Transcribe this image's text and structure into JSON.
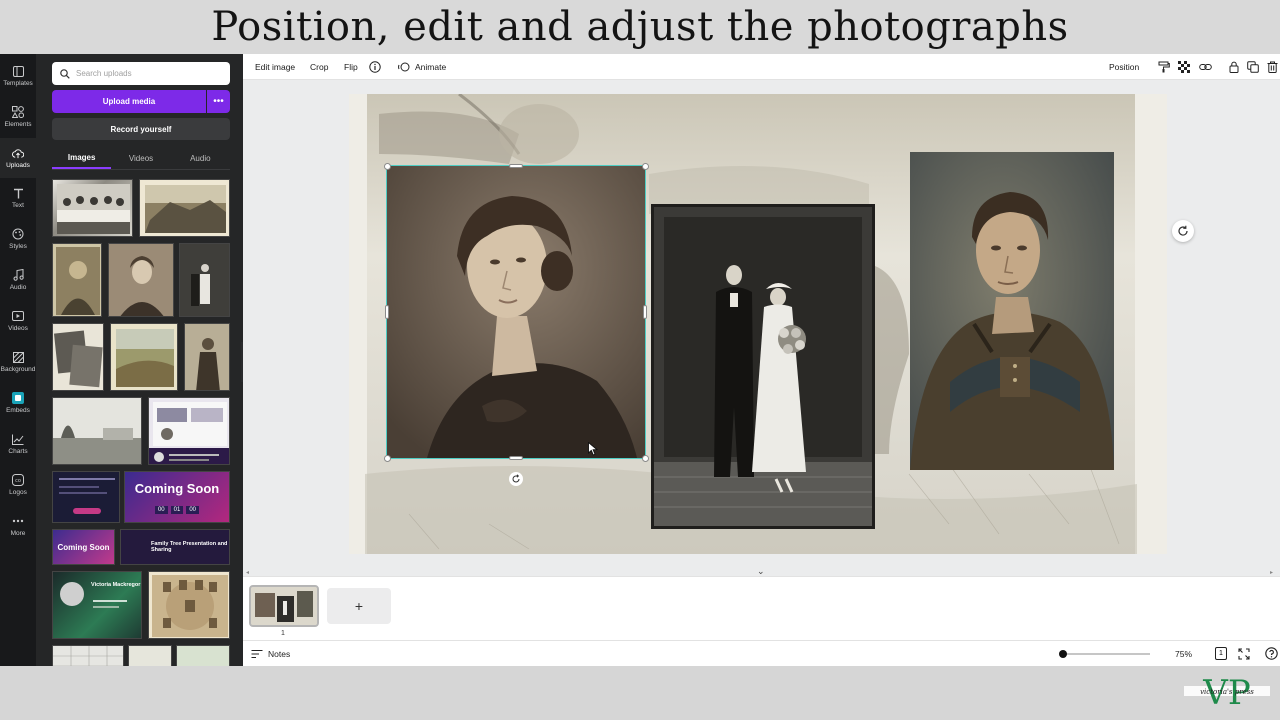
{
  "banner": {
    "title": "Position, edit and adjust the photographs"
  },
  "rail": {
    "items": [
      {
        "label": "Templates",
        "icon": "templates-icon"
      },
      {
        "label": "Elements",
        "icon": "elements-icon"
      },
      {
        "label": "Uploads",
        "icon": "cloud-upload-icon",
        "active": true
      },
      {
        "label": "Text",
        "icon": "text-icon"
      },
      {
        "label": "Styles",
        "icon": "palette-icon"
      },
      {
        "label": "Audio",
        "icon": "music-note-icon"
      },
      {
        "label": "Videos",
        "icon": "video-icon"
      },
      {
        "label": "Background",
        "icon": "background-icon"
      },
      {
        "label": "Embeds",
        "icon": "embeds-icon"
      },
      {
        "label": "Charts",
        "icon": "chart-icon"
      },
      {
        "label": "Logos",
        "icon": "logo-icon"
      },
      {
        "label": "More",
        "icon": "more-icon"
      }
    ]
  },
  "panel": {
    "search_placeholder": "Search uploads",
    "upload_label": "Upload media",
    "upload_more": "•••",
    "record_label": "Record yourself",
    "tabs": [
      "Images",
      "Videos",
      "Audio"
    ],
    "cards": {
      "coming_soon": "Coming Soon",
      "coming_soon_digits": [
        "00",
        "01",
        "00"
      ],
      "family_tree": "Family Tree Presentation and Sharing",
      "victoria": "Victoria Mackregor"
    }
  },
  "toolbar": {
    "edit_image": "Edit image",
    "crop": "Crop",
    "flip": "Flip",
    "animate": "Animate",
    "position": "Position"
  },
  "strip": {
    "page_number": "1",
    "add_page": "+"
  },
  "footer": {
    "notes": "Notes",
    "zoom": "75%",
    "zoom_level": 0.25
  },
  "brand": {
    "monogram": "VP",
    "tagline": "victoria's press"
  },
  "colors": {
    "accent": "#7d2ae8",
    "selection": "#4ecdc4",
    "rail_bg": "#18191b",
    "panel_bg": "#252627"
  }
}
